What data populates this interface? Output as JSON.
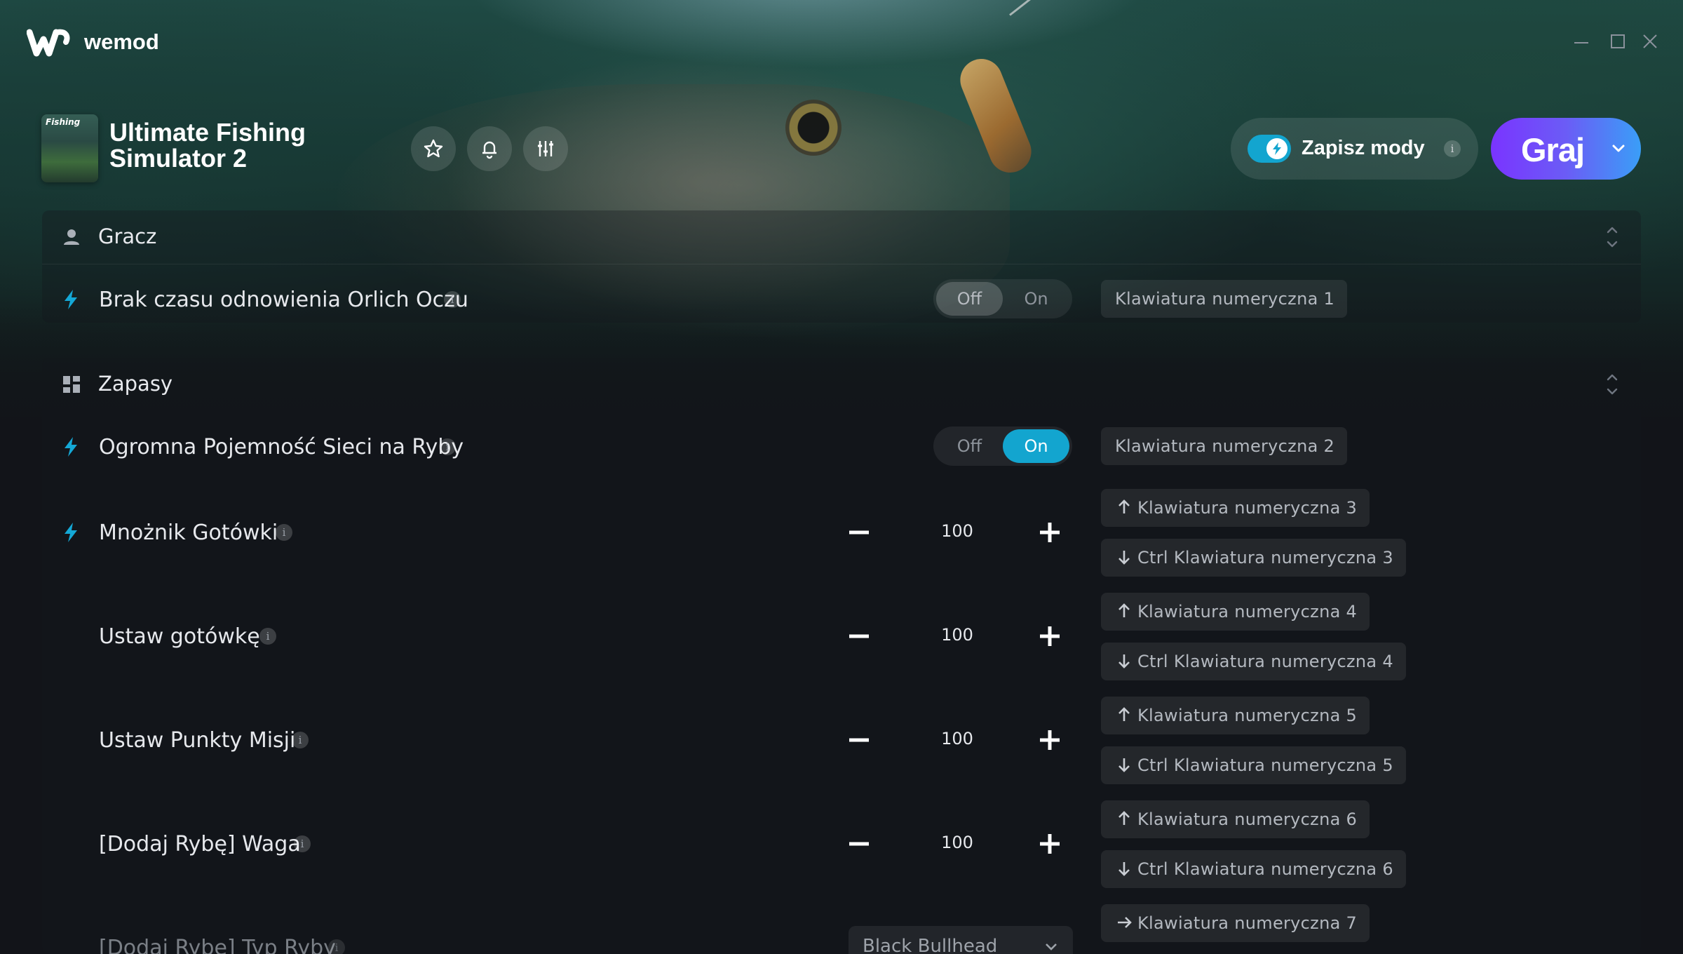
{
  "app": {
    "brand": "wemod"
  },
  "window_controls": [
    "minimize-icon",
    "maximize-icon",
    "close-icon"
  ],
  "game": {
    "title": "Ultimate Fishing Simulator 2",
    "thumbnail_label": "Fishing",
    "actions": [
      "star-icon",
      "bell-icon",
      "sliders-icon"
    ]
  },
  "header": {
    "save_mods_label": "Zapisz mody",
    "save_mods_enabled": true,
    "info_glyph": "i",
    "play_label": "Graj"
  },
  "colors": {
    "accent": "#13a5cf",
    "play_gradient": [
      "#7a34ff",
      "#3a9ef7"
    ]
  },
  "sections": [
    {
      "label": "Gracz",
      "icon": "user-icon",
      "mods": [
        {
          "name": "Brak czasu odnowienia Orlich Oczu",
          "type": "toggle",
          "off_label": "Off",
          "on_label": "On",
          "state": "Off",
          "hotkeys": [
            "Klawiatura numeryczna 1"
          ]
        }
      ]
    },
    {
      "label": "Zapasy",
      "icon": "grid-icon",
      "mods": [
        {
          "name": "Ogromna Pojemność Sieci na Ryby",
          "type": "toggle",
          "off_label": "Off",
          "on_label": "On",
          "state": "On",
          "hotkeys": [
            "Klawiatura numeryczna 2"
          ]
        },
        {
          "name": "Mnożnik Gotówki",
          "type": "stepper",
          "value": "100",
          "hotkeys": [
            "Klawiatura numeryczna 3",
            "Ctrl Klawiatura numeryczna 3"
          ]
        },
        {
          "name": "Ustaw gotówkę",
          "type": "stepper",
          "value": "100",
          "hotkeys": [
            "Klawiatura numeryczna 4",
            "Ctrl Klawiatura numeryczna 4"
          ]
        },
        {
          "name": "Ustaw Punkty Misji",
          "type": "stepper",
          "value": "100",
          "hotkeys": [
            "Klawiatura numeryczna 5",
            "Ctrl Klawiatura numeryczna 5"
          ]
        },
        {
          "name": "[Dodaj Rybę] Waga",
          "type": "stepper",
          "value": "100",
          "hotkeys": [
            "Klawiatura numeryczna 6",
            "Ctrl Klawiatura numeryczna 6"
          ]
        },
        {
          "name": "[Dodaj Rybę] Typ Ryby",
          "type": "select",
          "value": "Black Bullhead",
          "hotkeys": [
            "Klawiatura numeryczna 7"
          ]
        }
      ]
    }
  ]
}
